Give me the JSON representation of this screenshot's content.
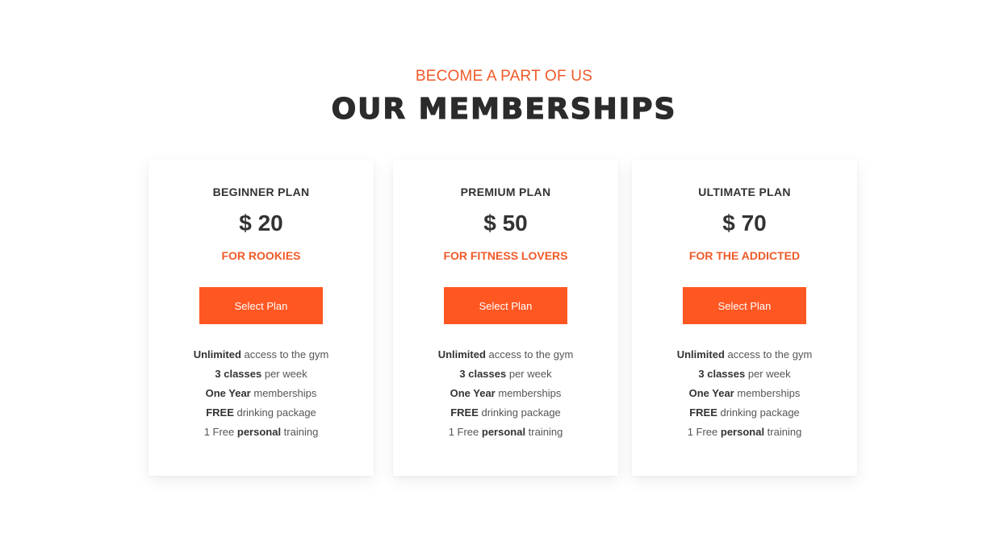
{
  "header": {
    "eyebrow": "BECOME A PART OF US",
    "title": "OUR MEMBERSHIPS"
  },
  "theme": {
    "accent": "#ff5722",
    "accent_text": "#f05a28",
    "heading": "#2b2b2b"
  },
  "plans": [
    {
      "name": "BEGINNER PLAN",
      "price": "$ 20",
      "tagline": "FOR ROOKIES",
      "button_label": "Select Plan",
      "features": [
        {
          "bold": "Unlimited",
          "rest": " access to the gym"
        },
        {
          "bold": "3 classes",
          "rest": " per week"
        },
        {
          "bold": "One Year",
          "rest": " memberships"
        },
        {
          "bold": "FREE",
          "rest": " drinking package"
        },
        {
          "pre": "1 Free ",
          "bold": "personal",
          "rest": " training"
        }
      ]
    },
    {
      "name": "PREMIUM PLAN",
      "price": "$ 50",
      "tagline": "FOR FITNESS LOVERS",
      "button_label": "Select Plan",
      "features": [
        {
          "bold": "Unlimited",
          "rest": " access to the gym"
        },
        {
          "bold": "3 classes",
          "rest": " per week"
        },
        {
          "bold": "One Year",
          "rest": " memberships"
        },
        {
          "bold": "FREE",
          "rest": " drinking package"
        },
        {
          "pre": "1 Free ",
          "bold": "personal",
          "rest": " training"
        }
      ]
    },
    {
      "name": "ULTIMATE PLAN",
      "price": "$ 70",
      "tagline": "FOR THE ADDICTED",
      "button_label": "Select Plan",
      "features": [
        {
          "bold": "Unlimited",
          "rest": " access to the gym"
        },
        {
          "bold": "3 classes",
          "rest": " per week"
        },
        {
          "bold": "One Year",
          "rest": " memberships"
        },
        {
          "bold": "FREE",
          "rest": " drinking package"
        },
        {
          "pre": "1 Free ",
          "bold": "personal",
          "rest": " training"
        }
      ]
    }
  ]
}
